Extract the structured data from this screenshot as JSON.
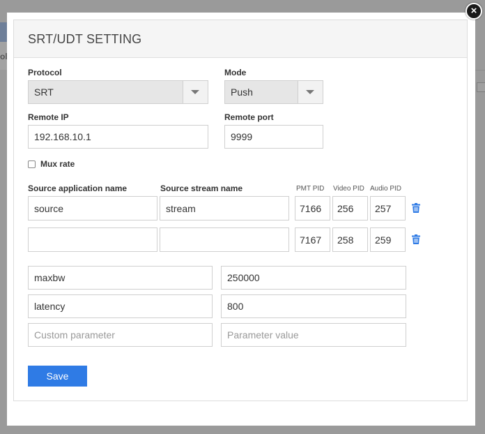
{
  "dialog": {
    "title": "SRT/UDT SETTING",
    "close_symbol": "×",
    "close_icon": "close-circle-icon"
  },
  "background": {
    "partial_label": "ol"
  },
  "form": {
    "protocol": {
      "label": "Protocol",
      "value": "SRT"
    },
    "mode": {
      "label": "Mode",
      "value": "Push"
    },
    "remote_ip": {
      "label": "Remote IP",
      "value": "192.168.10.1"
    },
    "remote_port": {
      "label": "Remote port",
      "value": "9999"
    },
    "mux_rate": {
      "label": "Mux rate",
      "checked": false
    }
  },
  "streams": {
    "headers": {
      "source_app": "Source application name",
      "source_stream": "Source stream name",
      "pmt_pid": "PMT PID",
      "video_pid": "Video PID",
      "audio_pid": "Audio PID"
    },
    "rows": [
      {
        "app": "source",
        "stream": "stream",
        "pmt": "7166",
        "video": "256",
        "audio": "257"
      },
      {
        "app": "",
        "stream": "",
        "pmt": "7167",
        "video": "258",
        "audio": "259"
      }
    ],
    "delete_icon": "trash-icon"
  },
  "params": {
    "rows": [
      {
        "name": "maxbw",
        "value": "250000"
      },
      {
        "name": "latency",
        "value": "800"
      }
    ],
    "custom": {
      "name_placeholder": "Custom parameter",
      "value_placeholder": "Parameter value"
    }
  },
  "actions": {
    "save_label": "Save"
  },
  "colors": {
    "primary": "#2f7be5",
    "trash": "#2f7be5",
    "overlay": "#8a8a8a"
  }
}
